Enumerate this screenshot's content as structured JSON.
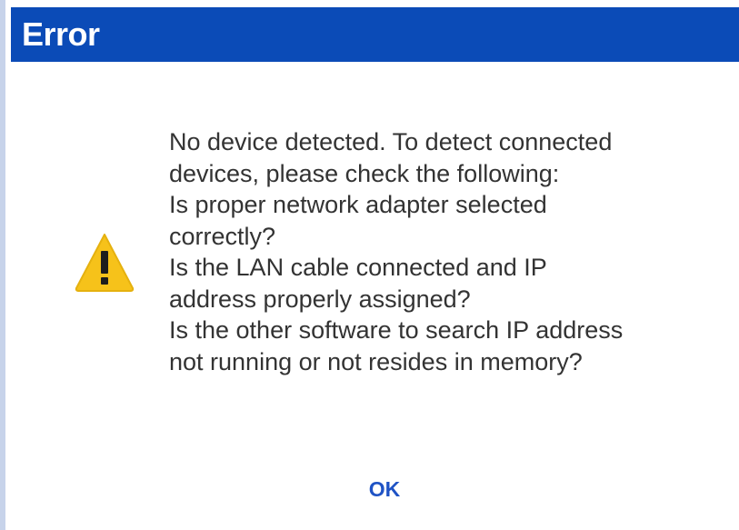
{
  "dialog": {
    "title": "Error",
    "icon": "warning-icon",
    "colors": {
      "titlebar": "#0b4bb7",
      "warning_fill": "#f6c21a",
      "ok_text": "#1f53c5"
    },
    "message_lines": [
      "No device detected. To detect connected",
      "devices, please check the following:",
      "Is proper network adapter selected",
      "correctly?",
      "Is the LAN cable connected and IP",
      "address properly assigned?",
      "Is the other software to search IP address",
      "not running or not resides in memory?"
    ],
    "ok_label": "OK"
  }
}
